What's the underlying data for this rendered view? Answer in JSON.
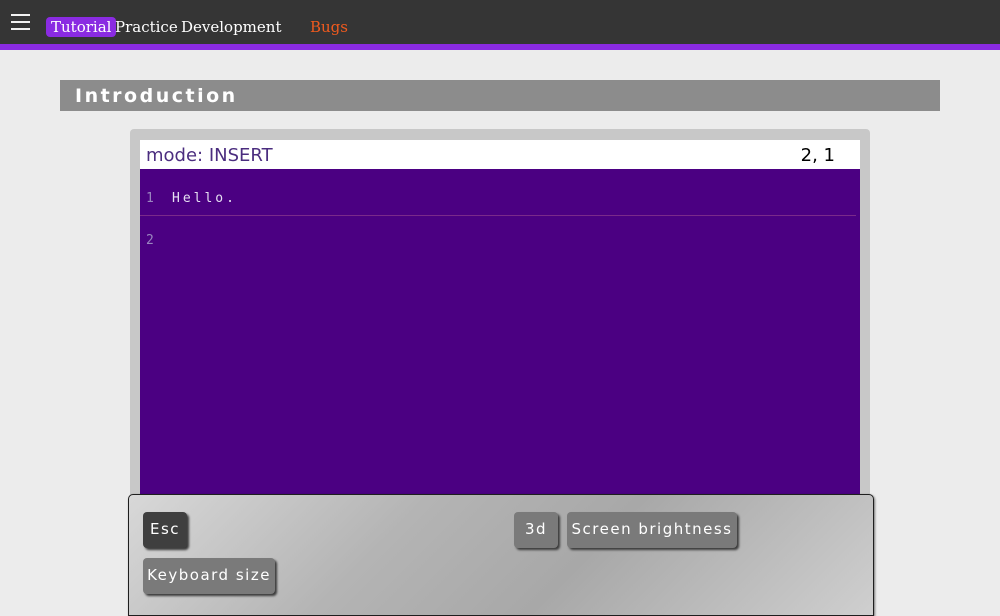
{
  "nav": {
    "menu_icon": "hamburger-menu-icon",
    "items": [
      {
        "label": "Tutorial",
        "active": true
      },
      {
        "label": "Practice"
      },
      {
        "label": "Development"
      },
      {
        "label": "Bugs"
      }
    ],
    "colors": {
      "bar": "#353535",
      "accent": "#8a2be2",
      "bugs": "#f05a1e"
    }
  },
  "section": {
    "title": "Introduction"
  },
  "editor": {
    "mode": "mode: INSERT",
    "cursor": "2, 1",
    "lines": [
      {
        "number": "1",
        "text": "Hello."
      },
      {
        "number": "2",
        "text": ""
      }
    ],
    "background": "#4b0082"
  },
  "keyboard": {
    "esc": "Esc",
    "three_d": "3d",
    "brightness": "Screen brightness",
    "keyboard_size": "Keyboard size"
  }
}
